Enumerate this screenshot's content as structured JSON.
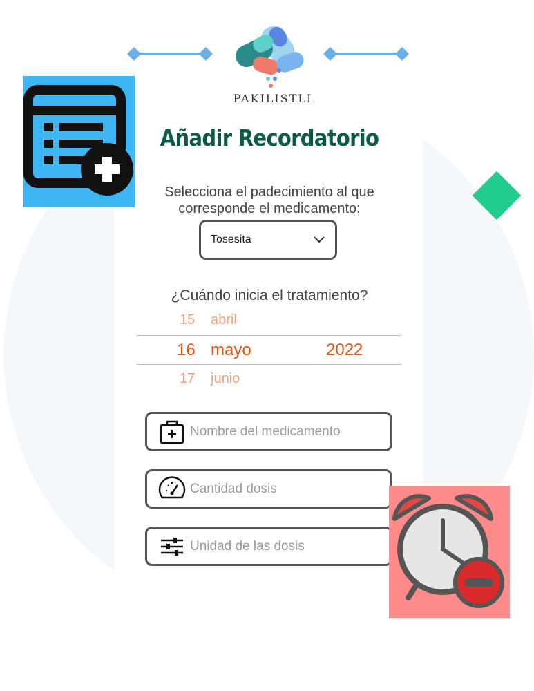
{
  "header": {
    "brand": "PAKILISTLI",
    "title": "Añadir Recordatorio"
  },
  "condition": {
    "question": "Selecciona el padecimiento al que corresponde el medicamento:",
    "selected": "Tosesita"
  },
  "start_date": {
    "question": "¿Cuándo inicia el tratamiento?",
    "prev": {
      "day": "15",
      "month": "abril"
    },
    "current": {
      "day": "16",
      "month": "mayo",
      "year": "2022"
    },
    "next": {
      "day": "17",
      "month": "junio"
    }
  },
  "fields": {
    "medication_name_placeholder": "Nombre del medicamento",
    "dose_quantity_placeholder": "Cantidad dosis",
    "dose_unit_placeholder": "Unidad de las dosis"
  },
  "colors": {
    "title": "#0d5a4a",
    "accent_date": "#e8500f",
    "faded_date": "#f4a07a",
    "calendar_sticker": "#3fb6f4",
    "clock_sticker": "#ff8a8a",
    "diamond": "#22cc8c"
  },
  "icons": [
    "pills-logo-icon",
    "chevron-down-icon",
    "medical-kit-icon",
    "gauge-icon",
    "sliders-icon",
    "calendar-add-icon",
    "alarm-clock-remove-icon"
  ]
}
